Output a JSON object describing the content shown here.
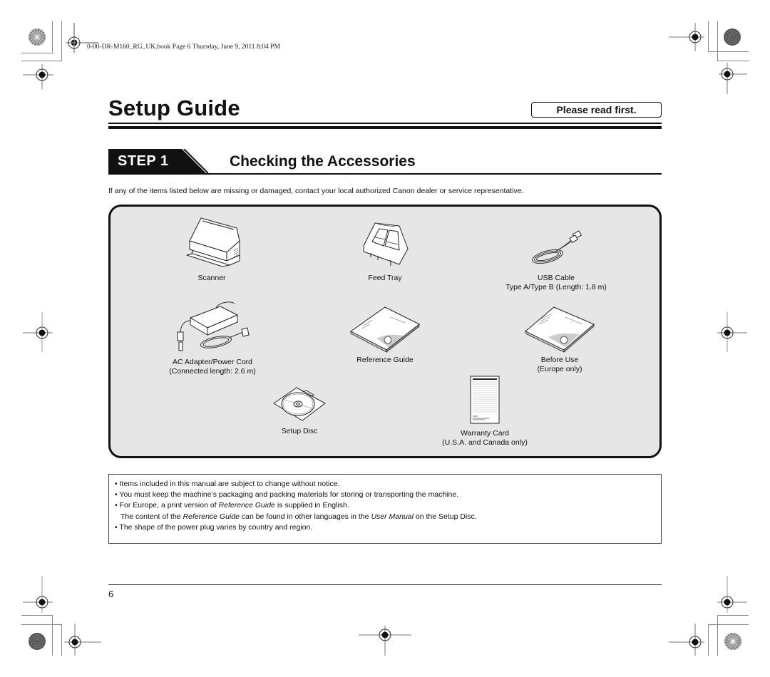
{
  "file_header": "0-00-DR-M160_RG_UK.book  Page 6  Thursday, June 9, 2011  8:04 PM",
  "title": "Setup Guide",
  "badge": "Please read first.",
  "step": {
    "label": "STEP 1",
    "title": "Checking the Accessories"
  },
  "intro": "If any of the items listed below are missing or damaged, contact your local authorized Canon dealer or service representative.",
  "accessories": [
    {
      "name": "Scanner",
      "detail": "",
      "icon": "scanner-icon"
    },
    {
      "name": "Feed Tray",
      "detail": "",
      "icon": "feed-tray-icon"
    },
    {
      "name": "USB Cable",
      "detail": "Type A/Type B (Length: 1.8 m)",
      "icon": "usb-cable-icon"
    },
    {
      "name": "AC Adapter/Power Cord",
      "detail": "(Connected length: 2.6 m)",
      "icon": "ac-adapter-icon"
    },
    {
      "name": "Reference Guide",
      "detail": "",
      "icon": "booklet-icon"
    },
    {
      "name": "Before Use",
      "detail": "(Europe only)",
      "icon": "booklet-icon"
    },
    {
      "name": "Setup Disc",
      "detail": "",
      "icon": "disc-icon"
    },
    {
      "name": "Warranty Card",
      "detail": "(U.S.A. and Canada only)",
      "icon": "warranty-card-icon"
    }
  ],
  "notes": {
    "n1": "Items included in this manual are subject to change without notice.",
    "n2": "You must keep the machine’s packaging and packing materials for storing or transporting the machine.",
    "n3_a": "For Europe, a print version of ",
    "n3_b": "Reference Guide",
    "n3_c": " is supplied in English.",
    "n3_d": "The content of the ",
    "n3_e": "Reference Guide",
    "n3_f": " can be found in other languages in the ",
    "n3_g": "User Manual",
    "n3_h": " on the Setup Disc.",
    "n4": "The shape of the power plug varies by country and region.",
    "bullet": "•"
  },
  "page_number": "6"
}
